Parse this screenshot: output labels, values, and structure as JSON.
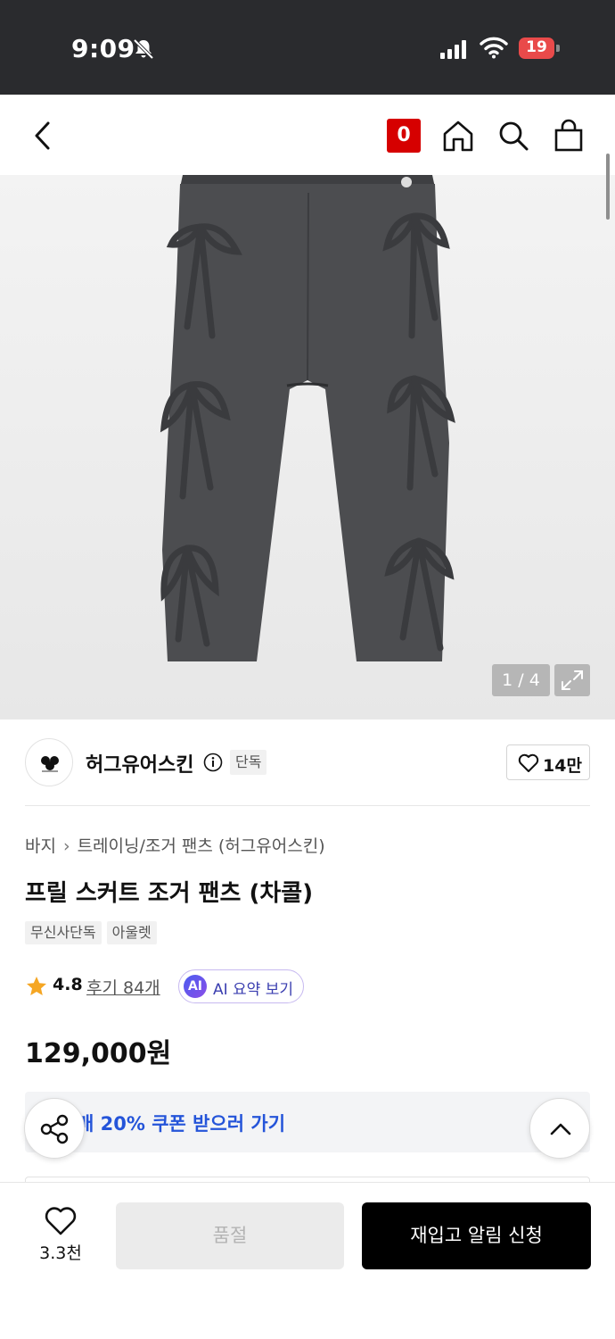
{
  "status_bar": {
    "time": "9:09",
    "battery": "19"
  },
  "nav": {
    "cart_count": "0"
  },
  "gallery": {
    "pager": "1 / 4"
  },
  "brand": {
    "name": "허그유어스킨",
    "badge": "단독",
    "likes": "14만"
  },
  "product": {
    "breadcrumb": [
      "바지",
      "트레이닝/조거 팬츠 (허그유어스킨)"
    ],
    "title": "프릴 스커트 조거 팬츠 (차콜)",
    "tags": [
      "무신사단독",
      "아울렛"
    ],
    "rating": "4.8",
    "reviews": "후기 84개",
    "ai_summary": "AI 요약 보기",
    "ai_badge": "AI",
    "price": "129,000원"
  },
  "coupon": {
    "text": "매 20% 쿠폰 받으러 가기"
  },
  "bottom_bar": {
    "wish_count": "3.3천",
    "soldout": "품절",
    "restock": "재입고 알림 신청"
  },
  "colors": {
    "accent_red": "#d60000",
    "coupon_blue": "#2454d9",
    "status_bg": "#2a2b2e",
    "product_gray": "#4c4d50"
  }
}
